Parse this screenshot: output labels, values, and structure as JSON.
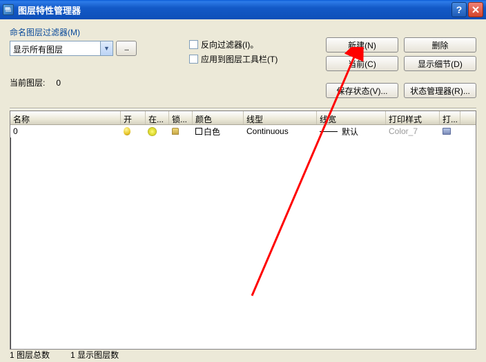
{
  "window": {
    "title": "图层特性管理器"
  },
  "filter": {
    "label": "命名图层过滤器(M)",
    "combo_value": "显示所有图层",
    "browse_label": "...",
    "invert_label": "反向过滤器(I)。",
    "apply_toolbar_label": "应用到图层工具栏(T)"
  },
  "buttons": {
    "new": "新建(N)",
    "delete": "删除",
    "current": "当前(C)",
    "show_details": "显示细节(D)",
    "save_state": "保存状态(V)...",
    "state_manager": "状态管理器(R)..."
  },
  "current_layer": {
    "label": "当前图层:",
    "value": "0"
  },
  "table": {
    "headers": {
      "name": "名称",
      "on": "开",
      "freeze": "在...",
      "lock": "锁...",
      "color": "颜色",
      "linetype": "线型",
      "lineweight": "线宽",
      "plotstyle": "打印样式",
      "plot": "打..."
    },
    "rows": [
      {
        "name": "0",
        "color_label": "白色",
        "linetype": "Continuous",
        "lineweight": "默认",
        "plotstyle": "Color_7"
      }
    ]
  },
  "footer": {
    "total_prefix": "1",
    "total_label": "图层总数",
    "shown_prefix": "1",
    "shown_label": "显示图层数"
  }
}
